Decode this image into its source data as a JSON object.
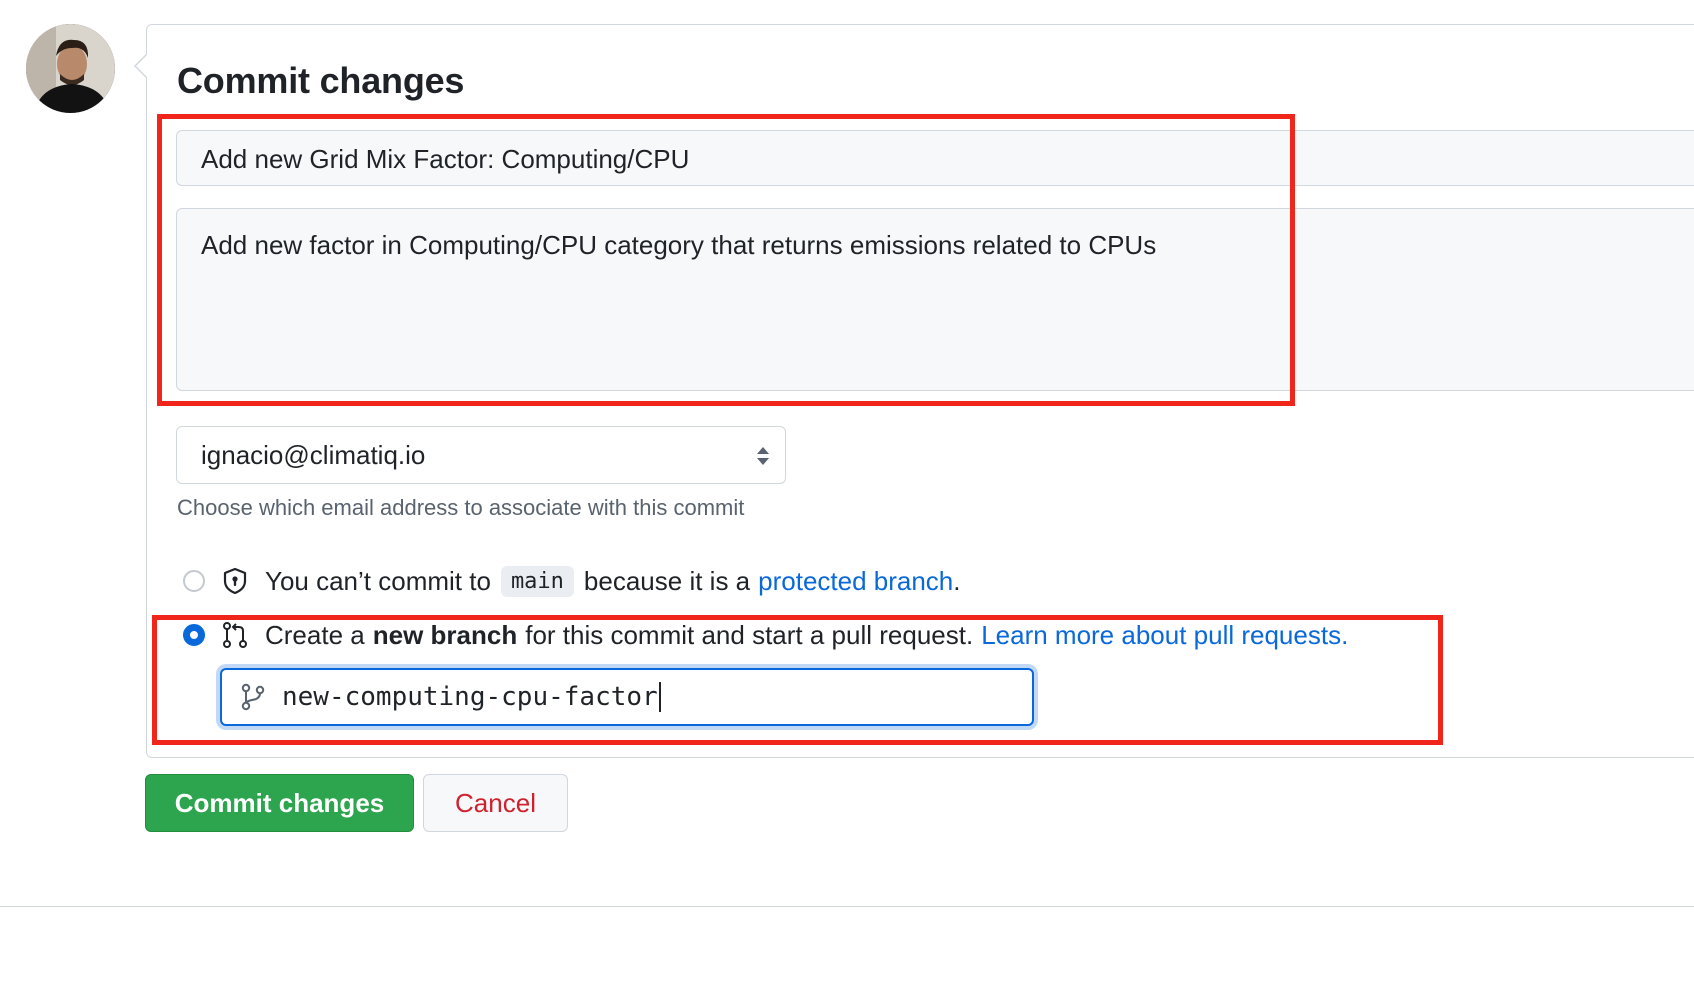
{
  "form": {
    "title": "Commit changes",
    "summary_value": "Add new Grid Mix Factor: Computing/CPU",
    "description_value": "Add new factor in Computing/CPU category that returns emissions related to CPUs",
    "email_selected": "ignacio@climatiq.io",
    "email_hint": "Choose which email address to associate with this commit"
  },
  "options": {
    "direct": {
      "prefix": "You can’t commit to",
      "branch": "main",
      "middle": "because it is a",
      "link": "protected branch",
      "suffix": "."
    },
    "new_branch": {
      "prefix": "Create a",
      "bold": "new branch",
      "middle": "for this commit and start a pull request.",
      "link": "Learn more about pull requests.",
      "branch_name": "new-computing-cpu-factor"
    }
  },
  "buttons": {
    "commit": "Commit changes",
    "cancel": "Cancel"
  },
  "colors": {
    "primary_green": "#2da44e",
    "link_blue": "#0969da",
    "danger_red": "#cf222e",
    "annotation_red": "#f0261b"
  },
  "icons": {
    "avatar": "user-avatar",
    "shield": "shield-lock-icon",
    "pull_request": "git-pull-request-icon",
    "branch": "git-branch-icon",
    "select": "select-arrows-icon"
  }
}
